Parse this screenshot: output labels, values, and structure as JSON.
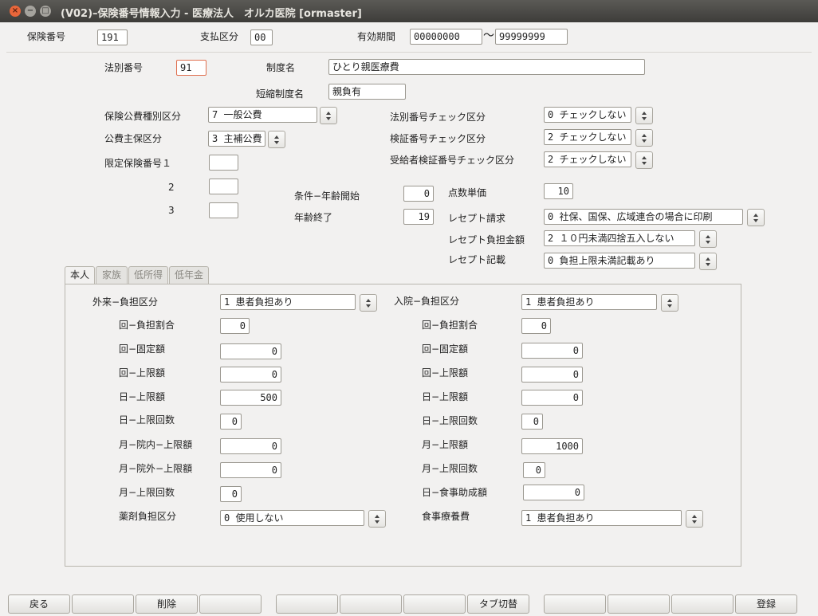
{
  "window": {
    "title": "(V02)–保険番号情報入力 - 医療法人　オルカ医院 [ormaster]"
  },
  "header": {
    "hoken_bango_label": "保険番号",
    "hoken_bango_value": "191",
    "shiharai_label": "支払区分",
    "shiharai_value": "00",
    "yuko_label": "有効期間",
    "yuko_from": "00000000",
    "yuko_tilde": "〜",
    "yuko_to": "99999999"
  },
  "main": {
    "hobetsu_label": "法別番号",
    "hobetsu_value": "91",
    "seido_label": "制度名",
    "seido_value": "ひとり親医療費",
    "tanshuku_label": "短縮制度名",
    "tanshuku_value": "親負有",
    "kohi_shubetsu_label": "保険公費種別区分",
    "kohi_shubetsu_value": "7 一般公費",
    "kohi_shuho_label": "公費主保区分",
    "kohi_shuho_value": "3 主補公費",
    "gentei_label": "限定保険番号１",
    "gentei_2": "2",
    "gentei_3": "3",
    "hobetsu_check_label": "法別番号チェック区分",
    "hobetsu_check_value": "0 チェックしない",
    "kensho_check_label": "検証番号チェック区分",
    "kensho_check_value": "2 チェックしない",
    "jukyu_check_label": "受給者検証番号チェック区分",
    "jukyu_check_value": "2 チェックしない",
    "joken_label": "条件−年齢開始",
    "joken_value": "0",
    "nenrei_end_label": "年齢終了",
    "nenrei_end_value": "19",
    "tensu_label": "点数単価",
    "tensu_value": "10",
    "receipt_seikyu_label": "レセプト請求",
    "receipt_seikyu_value": "0 社保、国保、広域連合の場合に印刷",
    "receipt_futan_label": "レセプト負担金額",
    "receipt_futan_value": "2 １０円未満四捨五入しない",
    "receipt_kisai_label": "レセプト記載",
    "receipt_kisai_value": "0 負担上限未満記載あり"
  },
  "tabs": [
    {
      "label": "本人"
    },
    {
      "label": "家族"
    },
    {
      "label": "低所得"
    },
    {
      "label": "低年金"
    }
  ],
  "gairai": {
    "futan_label": "外来−負担区分",
    "futan_value": "1 患者負担あり",
    "rows": [
      {
        "label": "回−負担割合",
        "value": "0"
      },
      {
        "label": "回−固定額",
        "value": "0"
      },
      {
        "label": "回−上限額",
        "value": "0"
      },
      {
        "label": "日−上限額",
        "value": "500"
      },
      {
        "label": "日−上限回数",
        "value": "0"
      },
      {
        "label": "月−院内−上限額",
        "value": "0"
      },
      {
        "label": "月−院外−上限額",
        "value": "0"
      },
      {
        "label": "月−上限回数",
        "value": "0"
      }
    ],
    "yakuzai_label": "薬剤負担区分",
    "yakuzai_value": "0 使用しない"
  },
  "nyuin": {
    "futan_label": "入院−負担区分",
    "futan_value": "1 患者負担あり",
    "rows": [
      {
        "label": "回−負担割合",
        "value": "0"
      },
      {
        "label": "回−固定額",
        "value": "0"
      },
      {
        "label": "回−上限額",
        "value": "0"
      },
      {
        "label": "日−上限額",
        "value": "0"
      },
      {
        "label": "日−上限回数",
        "value": "0"
      },
      {
        "label": "月−上限額",
        "value": "1000"
      },
      {
        "label": "月−上限回数",
        "value": "0"
      },
      {
        "label": "日−食事助成額",
        "value": "0"
      }
    ],
    "shokuji_label": "食事療養費",
    "shokuji_value": "1 患者負担あり"
  },
  "footer": {
    "buttons": [
      "戻る",
      "",
      "削除",
      "",
      "",
      "",
      "",
      "タブ切替",
      "",
      "",
      "",
      "登録"
    ]
  }
}
